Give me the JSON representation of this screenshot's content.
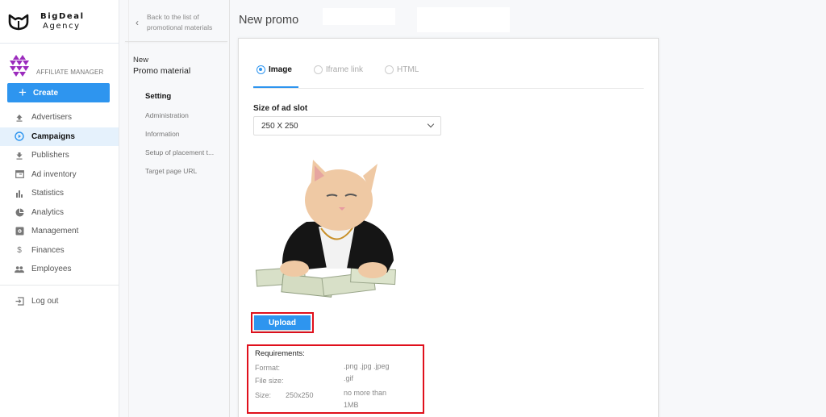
{
  "brand": {
    "name_line1": "BigDeal",
    "name_line2": "Agency"
  },
  "user": {
    "role": "AFFILIATE MANAGER"
  },
  "sidebar": {
    "create_label": "Create",
    "items": [
      {
        "label": "Advertisers",
        "icon": "upload-icon",
        "active": false
      },
      {
        "label": "Campaigns",
        "icon": "play-circle-icon",
        "active": true
      },
      {
        "label": "Publishers",
        "icon": "download-icon",
        "active": false
      },
      {
        "label": "Ad inventory",
        "icon": "browser-window-icon",
        "active": false
      },
      {
        "label": "Statistics",
        "icon": "bar-chart-icon",
        "active": false
      },
      {
        "label": "Analytics",
        "icon": "pie-chart-icon",
        "active": false
      },
      {
        "label": "Management",
        "icon": "settings-box-icon",
        "active": false
      },
      {
        "label": "Finances",
        "icon": "dollar-icon",
        "active": false
      },
      {
        "label": "Employees",
        "icon": "people-icon",
        "active": false
      }
    ],
    "logout_label": "Log out"
  },
  "subpanel": {
    "back_line1": "Back to the list of",
    "back_line2": "promotional materials",
    "title_line1": "New",
    "title_line2": "Promo material",
    "items": [
      {
        "label": "Setting",
        "active": true
      },
      {
        "label": "Administration",
        "active": false
      },
      {
        "label": "Information",
        "active": false
      },
      {
        "label": "Setup of placement t...",
        "active": false
      },
      {
        "label": "Target page URL",
        "active": false
      }
    ]
  },
  "main": {
    "title": "New promo",
    "tabs": [
      {
        "label": "Image",
        "selected": true
      },
      {
        "label": "Iframe link",
        "selected": false
      },
      {
        "label": "HTML",
        "selected": false
      }
    ],
    "slot_label": "Size of ad slot",
    "slot_value": "250 X 250",
    "upload_label": "Upload",
    "requirements": {
      "title": "Requirements:",
      "format_label": "Format:",
      "format_value_line1": ".png .jpg .jpeg",
      "format_value_line2": ".gif",
      "filesize_label": "File size:",
      "filesize_value_line1": "no more than",
      "filesize_value_line2": "1MB",
      "size_label": "Size:",
      "size_value": "250x250"
    }
  },
  "colors": {
    "accent": "#2e95ef",
    "highlight": "#e0101c",
    "active_bg": "#e5f1fc"
  }
}
